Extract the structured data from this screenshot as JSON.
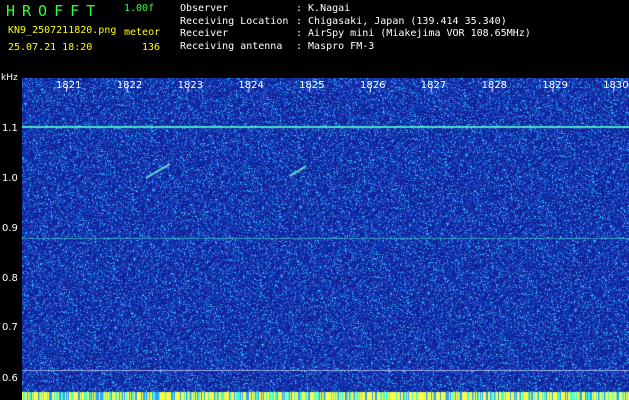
{
  "header": {
    "brand": "HROFFT",
    "version": "1.00f",
    "filename": "KN9_2507211820.png",
    "mode": "meteor",
    "timestamp": "25.07.21 18:20",
    "count": "136",
    "info": [
      {
        "label": "Observer",
        "value": ": K.Nagai"
      },
      {
        "label": "Receiving Location",
        "value": ": Chigasaki, Japan (139.414 35.340)"
      },
      {
        "label": "Receiver",
        "value": ": AirSpy mini (Miakejima VOR 108.65MHz)"
      },
      {
        "label": "Receiving antenna",
        "value": ": Maspro FM-3"
      }
    ]
  },
  "spectrogram": {
    "y_unit": "kHz",
    "y_ticks": [
      "1.1",
      "1.0",
      "0.9",
      "0.8",
      "0.7",
      "0.6"
    ],
    "x_ticks": [
      "1821",
      "1822",
      "1823",
      "1824",
      "1825",
      "1826",
      "1827",
      "1828",
      "1829",
      "1830"
    ],
    "colors": {
      "background": "#1020a0",
      "noise": "#2aa0ff",
      "signal": "#40ffd0",
      "bottom_band": "#ffff40"
    }
  }
}
